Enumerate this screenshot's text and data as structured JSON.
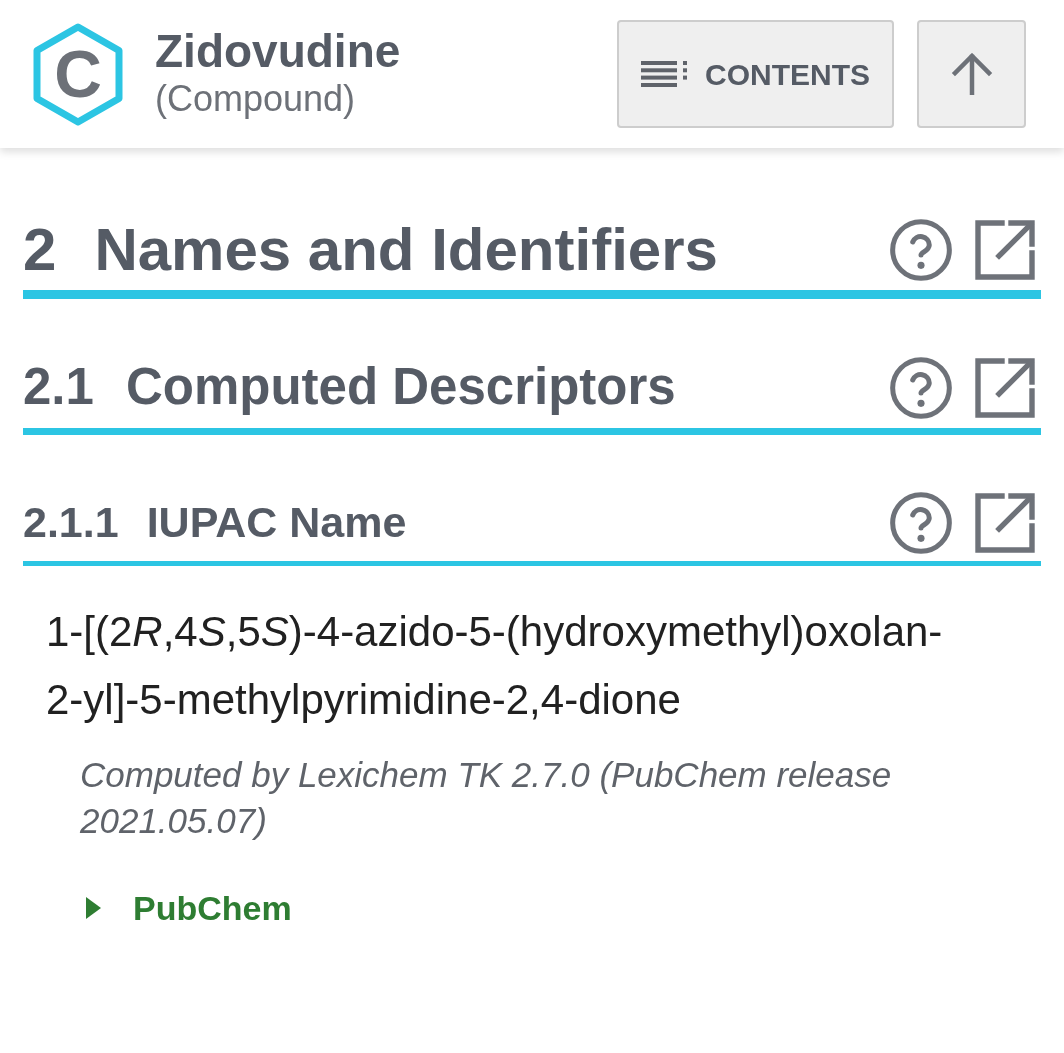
{
  "header": {
    "logo_letter": "C",
    "title": "Zidovudine",
    "subtitle": "(Compound)",
    "contents_button": "CONTENTS"
  },
  "sections": [
    {
      "kind": "section",
      "number": "2",
      "title": "Names and Identifiers"
    },
    {
      "kind": "subsection",
      "number": "2.1",
      "title": "Computed Descriptors"
    },
    {
      "kind": "subsubsection",
      "number": "2.1.1",
      "title": "IUPAC Name"
    }
  ],
  "iupac_name": {
    "value_parts": [
      {
        "text": "1-[(2",
        "italic": false
      },
      {
        "text": "R",
        "italic": true
      },
      {
        "text": ",4",
        "italic": false
      },
      {
        "text": "S",
        "italic": true
      },
      {
        "text": ",5",
        "italic": false
      },
      {
        "text": "S",
        "italic": true
      },
      {
        "text": ")-4-azido-5-(hydroxymethyl)oxolan-2-yl]-5-methylpyrimidine-2,4-dione",
        "italic": false
      }
    ],
    "reference": "Computed by Lexichem TK 2.7.0 (PubChem release 2021.05.07)",
    "source": {
      "label": "PubChem",
      "expanded": false
    }
  }
}
